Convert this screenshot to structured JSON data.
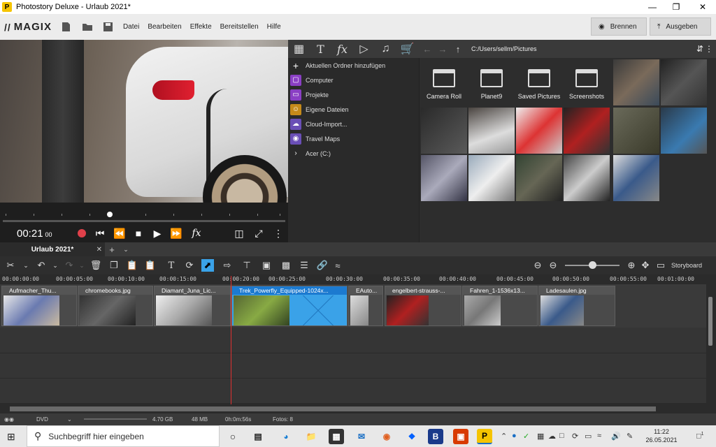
{
  "window": {
    "title": "Photostory Deluxe - Urlaub 2021*",
    "app_letter": "P"
  },
  "menubar": {
    "brand": "MAGIX",
    "menus": [
      "Datei",
      "Bearbeiten",
      "Effekte",
      "Bereitstellen",
      "Hilfe"
    ],
    "burn_label": "Brennen",
    "export_label": "Ausgeben"
  },
  "preview": {
    "timecode": "00:21",
    "frames": "00"
  },
  "pool": {
    "path": "C:/Users/sellm/Pictures",
    "tree": [
      {
        "label": "Aktuellen Ordner hinzufügen",
        "icon": "plus-icon",
        "color": ""
      },
      {
        "label": "Computer",
        "icon": "computer-icon",
        "color": "#8a3fc4"
      },
      {
        "label": "Projekte",
        "icon": "document-icon",
        "color": "#8a3fc4"
      },
      {
        "label": "Eigene Dateien",
        "icon": "user-icon",
        "color": "#c58a1a"
      },
      {
        "label": "Cloud-Import...",
        "icon": "cloud-icon",
        "color": "#6a4fb6"
      },
      {
        "label": "Travel Maps",
        "icon": "map-pin-icon",
        "color": "#6a4fb6"
      },
      {
        "label": "Acer (C:)",
        "icon": "chevron-right-icon",
        "color": ""
      }
    ],
    "folders": [
      "Camera Roll",
      "Planet9",
      "Saved Pictures",
      "Screenshots"
    ]
  },
  "timeline": {
    "project_tab": "Urlaub 2021*",
    "storyboard_label": "Storyboard",
    "ruler": [
      "00:00:00:00",
      "00:00:05:00",
      "00:00:10:00",
      "00:00:15:00",
      "00:00:20:00",
      "00:00:25:00",
      "00:00:30:00",
      "00:00:35:00",
      "00:00:40:00",
      "00:00:45:00",
      "00:00:50:00",
      "00:00:55:00",
      "00:01:00:00"
    ],
    "clips": [
      {
        "label": "Aufmacher_Thu...",
        "selected": false
      },
      {
        "label": "chromebooks.jpg",
        "selected": false
      },
      {
        "label": "Diamant_Juna_Lic...",
        "selected": false
      },
      {
        "label": "Trek_Powerfly_Equipped-1024x...",
        "selected": true
      },
      {
        "label": "EAuto...",
        "selected": false
      },
      {
        "label": "engelbert-strauss-...",
        "selected": false
      },
      {
        "label": "Fahren_1-1536x13...",
        "selected": false
      },
      {
        "label": "Ladesaulen.jpg",
        "selected": false
      }
    ]
  },
  "status": {
    "format": "DVD",
    "capacity": "4.70 GB",
    "size": "48 MB",
    "duration": "0h:0m:56s",
    "photos": "Fotos: 8"
  },
  "taskbar": {
    "search_placeholder": "Suchbegriff hier eingeben",
    "time": "11:22",
    "date": "26.05.2021",
    "notification_count": "1"
  }
}
